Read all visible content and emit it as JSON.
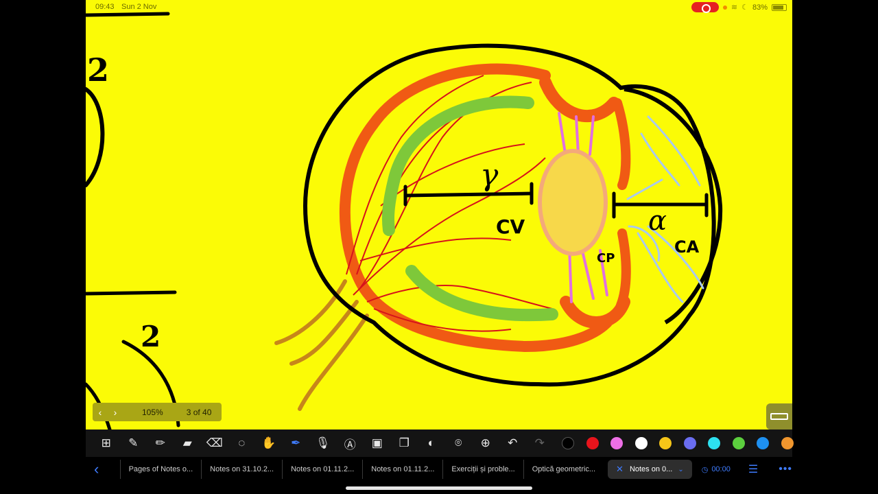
{
  "status": {
    "time": "09:43",
    "date": "Sun 2 Nov",
    "battery": "83%"
  },
  "canvas": {
    "background": "#fbfb06",
    "labels": {
      "gamma": "γ",
      "alpha": "α",
      "cv": "CV",
      "cp": "CP",
      "ca": "CA"
    },
    "left_marks": [
      "2",
      "2"
    ]
  },
  "page_indicator": {
    "zoom": "105%",
    "page": "3 of 40"
  },
  "toolbar": {
    "tools": [
      {
        "name": "pages-grid-icon",
        "glyph": "⊞"
      },
      {
        "name": "pen-icon",
        "glyph": "✎"
      },
      {
        "name": "pencil-icon",
        "glyph": "✏"
      },
      {
        "name": "highlighter-icon",
        "glyph": "▰"
      },
      {
        "name": "eraser-icon",
        "glyph": "⌫"
      },
      {
        "name": "lasso-icon",
        "glyph": "◌"
      },
      {
        "name": "hand-icon",
        "glyph": "✋"
      },
      {
        "name": "laser-pointer-icon",
        "glyph": "✒",
        "active": true
      },
      {
        "name": "microphone-icon",
        "glyph": "🎙"
      },
      {
        "name": "text-box-icon",
        "glyph": "Ⓐ"
      },
      {
        "name": "image-icon",
        "glyph": "▣"
      },
      {
        "name": "shapes-icon",
        "glyph": "❐"
      },
      {
        "name": "sticker-icon",
        "glyph": "◐"
      },
      {
        "name": "camera-icon",
        "glyph": "⌾"
      },
      {
        "name": "add-icon",
        "glyph": "⊕"
      },
      {
        "name": "undo-icon",
        "glyph": "↶"
      },
      {
        "name": "redo-icon",
        "glyph": "↷",
        "dim": true
      }
    ],
    "colors": [
      "#000000",
      "#e8141c",
      "#ee6fe6",
      "#ffffff",
      "#f5c518",
      "#6a6df0",
      "#2de1f0",
      "#5ccf3e",
      "#1e90f0",
      "#f0962e"
    ]
  },
  "tabs": [
    "Pages of Notes o...",
    "Notes on 31.10.2...",
    "Notes on 01.11.2...",
    "Notes on 01.11.2...",
    "Exerciții și proble...",
    "Optică geometric..."
  ],
  "active_tab": "Notes on 0...",
  "timer": "00:00"
}
